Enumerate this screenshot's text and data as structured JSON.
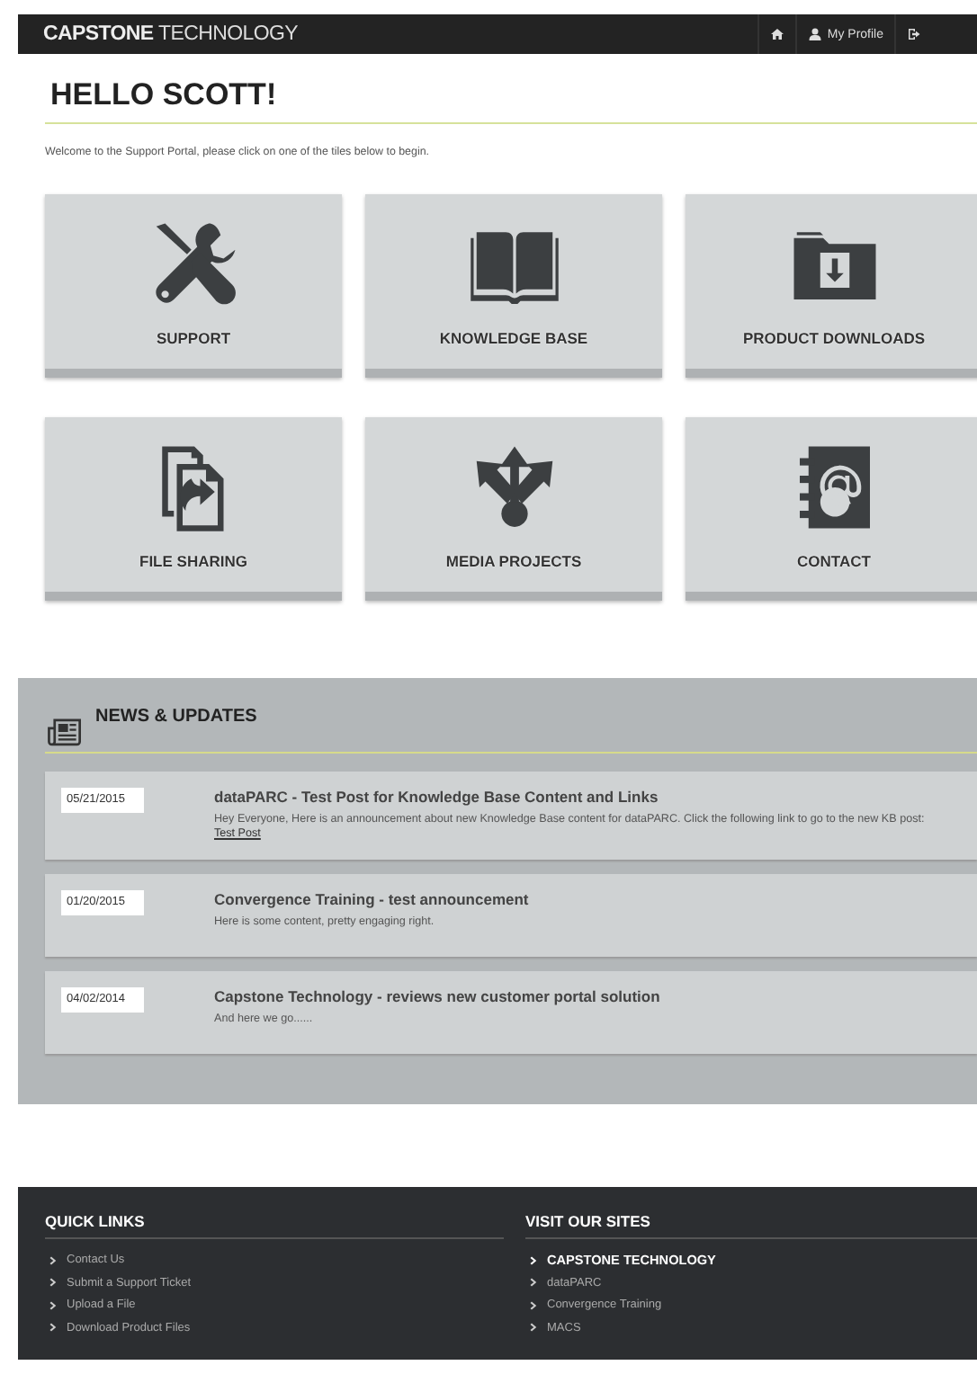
{
  "header": {
    "brand_bold": "CAPSTONE",
    "brand_light": "TECHNOLOGY",
    "nav": [
      {
        "kind": "home"
      },
      {
        "kind": "profile",
        "label": "My Profile"
      },
      {
        "kind": "logout"
      }
    ]
  },
  "greeting": "HELLO SCOTT!",
  "intro": "Welcome to the Support Portal, please click on one of the tiles below to begin.",
  "tiles": [
    {
      "kind": "tools",
      "label": "SUPPORT"
    },
    {
      "kind": "book",
      "label": "KNOWLEDGE BASE"
    },
    {
      "kind": "folder",
      "label": "PRODUCT DOWNLOADS"
    },
    {
      "kind": "files",
      "label": "FILE SHARING"
    },
    {
      "kind": "share",
      "label": "MEDIA PROJECTS"
    },
    {
      "kind": "contact",
      "label": "CONTACT"
    }
  ],
  "news": {
    "title": "NEWS & UPDATES",
    "items": [
      {
        "date": "05/21/2015",
        "title": "dataPARC - Test Post for Knowledge Base Content and Links",
        "body": "Hey Everyone, Here is an announcement about new Knowledge Base content for dataPARC. Click the following link to go to the new KB post:",
        "link": "Test Post"
      },
      {
        "date": "01/20/2015",
        "title": "Convergence Training - test announcement",
        "body": "Here is some content, pretty engaging right."
      },
      {
        "date": "04/02/2014",
        "title": "Capstone Technology - reviews new customer portal solution",
        "body": "And here we go......"
      }
    ]
  },
  "footer": {
    "columns": [
      {
        "title": "QUICK LINKS",
        "links": [
          {
            "label": "Contact Us",
            "selected": false
          },
          {
            "label": "Submit a Support Ticket",
            "selected": false
          },
          {
            "label": "Upload a File",
            "selected": false
          },
          {
            "label": "Download Product Files",
            "selected": false
          }
        ]
      },
      {
        "title": "VISIT OUR SITES",
        "links": [
          {
            "label": "CAPSTONE TECHNOLOGY",
            "selected": true
          },
          {
            "label": "dataPARC",
            "selected": false
          },
          {
            "label": "Convergence Training",
            "selected": false
          },
          {
            "label": "MACS",
            "selected": false
          }
        ]
      }
    ]
  }
}
